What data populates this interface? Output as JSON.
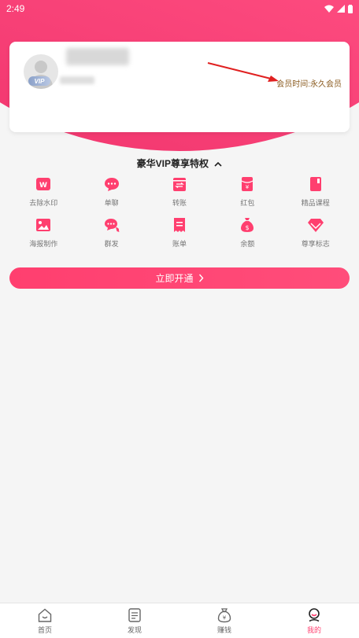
{
  "status_bar": {
    "time": "2:49"
  },
  "profile": {
    "member_time_text": "会员时间:永久会员",
    "vip_badge": "VIP"
  },
  "privileges": {
    "title": "豪华VIP尊享特权",
    "items": [
      {
        "label": "去除水印",
        "icon": "watermark-remove-icon"
      },
      {
        "label": "单聊",
        "icon": "chat-bubble-icon"
      },
      {
        "label": "转账",
        "icon": "transfer-icon"
      },
      {
        "label": "红包",
        "icon": "red-packet-icon"
      },
      {
        "label": "精品课程",
        "icon": "course-book-icon"
      },
      {
        "label": "海报制作",
        "icon": "poster-image-icon"
      },
      {
        "label": "群发",
        "icon": "group-message-icon"
      },
      {
        "label": "账单",
        "icon": "bill-icon"
      },
      {
        "label": "余额",
        "icon": "money-bag-icon"
      },
      {
        "label": "尊享标志",
        "icon": "diamond-icon"
      }
    ]
  },
  "open_button": {
    "label": "立即开通"
  },
  "bottom_nav": {
    "tabs": [
      {
        "label": "首页",
        "icon": "home-icon"
      },
      {
        "label": "发现",
        "icon": "discover-doc-icon"
      },
      {
        "label": "赚钱",
        "icon": "earn-bag-icon"
      },
      {
        "label": "我的",
        "icon": "profile-icon"
      }
    ],
    "active_index": 3
  },
  "colors": {
    "accent": "#ff3f6f",
    "member_text": "#8a5a1e",
    "annotation_arrow": "#e02020"
  }
}
